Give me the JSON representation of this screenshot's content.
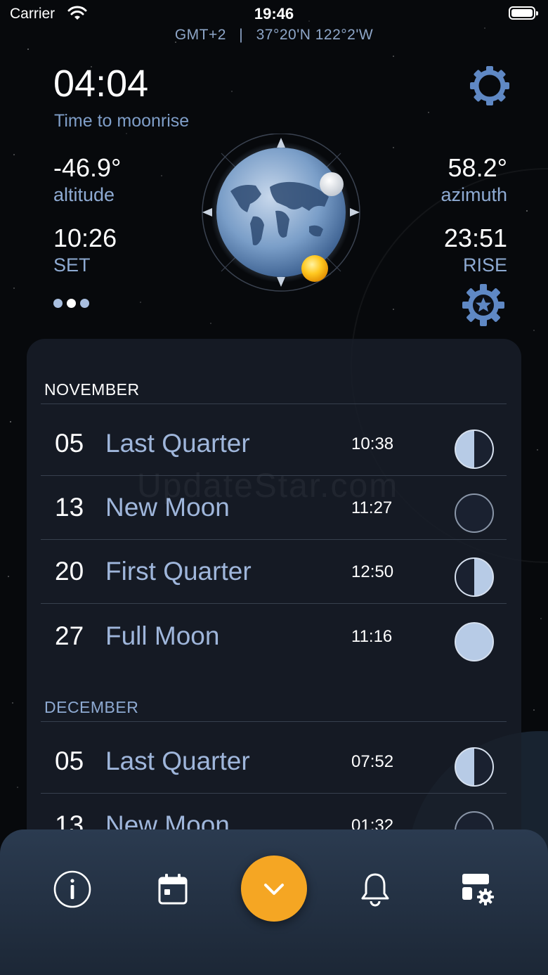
{
  "status_bar": {
    "carrier": "Carrier",
    "time": "19:46"
  },
  "location": {
    "timezone": "GMT+2",
    "separator": "|",
    "coordinates": "37°20'N 122°2'W"
  },
  "header": {
    "countdown": "04:04",
    "countdown_label": "Time to moonrise"
  },
  "stats": {
    "altitude_value": "-46.9°",
    "altitude_label": "altitude",
    "azimuth_value": "58.2°",
    "azimuth_label": "azimuth",
    "set_time": "10:26",
    "set_label": "SET",
    "rise_time": "23:51",
    "rise_label": "RISE"
  },
  "colors": {
    "accent": "#f5a623",
    "label_blue": "#8eaad2",
    "panel": "#181e2a",
    "moon_lit": "#b7cbe6"
  },
  "months": [
    {
      "name": "NOVEMBER",
      "phases": [
        {
          "day": "05",
          "name": "Last Quarter",
          "time": "10:38",
          "icon": "last-quarter-icon"
        },
        {
          "day": "13",
          "name": "New Moon",
          "time": "11:27",
          "icon": "new-moon-icon"
        },
        {
          "day": "20",
          "name": "First Quarter",
          "time": "12:50",
          "icon": "first-quarter-icon"
        },
        {
          "day": "27",
          "name": "Full Moon",
          "time": "11:16",
          "icon": "full-moon-icon"
        }
      ]
    },
    {
      "name": "DECEMBER",
      "phases": [
        {
          "day": "05",
          "name": "Last Quarter",
          "time": "07:52",
          "icon": "last-quarter-icon"
        },
        {
          "day": "13",
          "name": "New Moon",
          "time": "01:32",
          "icon": "new-moon-icon"
        }
      ]
    }
  ],
  "watermark": "UpdateStar.com",
  "bottom_nav": [
    "info-icon",
    "calendar-icon",
    "chevron-down-icon",
    "bell-icon",
    "layout-settings-icon"
  ]
}
